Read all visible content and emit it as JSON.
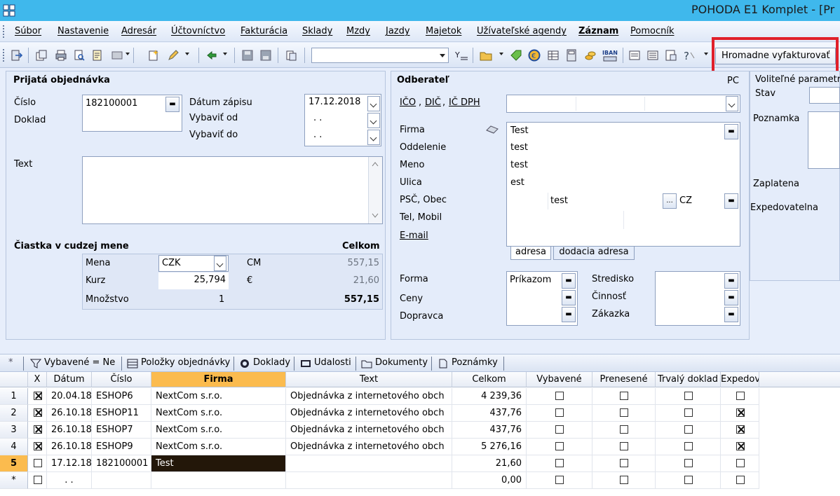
{
  "window": {
    "title": "POHODA E1 Komplet - [Pr"
  },
  "menu": [
    "Súbor",
    "Nastavenie",
    "Adresár",
    "Účtovníctvo",
    "Fakturácia",
    "Sklady",
    "Mzdy",
    "Jazdy",
    "Majetok",
    "Užívateľské agendy",
    "Záznam",
    "Pomocník"
  ],
  "toolbar": {
    "hromadne_label": "Hromadne vyfakturovať"
  },
  "order": {
    "section_title": "Prijatá objednávka",
    "cislo_label": "Číslo",
    "cislo_value": "182100001",
    "doklad_label": "Doklad",
    "datum_zapisu_label": "Dátum zápisu",
    "datum_zapisu_value": "17.12.2018",
    "vybavit_od_label": "Vybaviť od",
    "vybavit_od_value": ". .",
    "vybavit_do_label": "Vybaviť do",
    "vybavit_do_value": ". .",
    "text_label": "Text"
  },
  "foreign": {
    "section_title": "Čiastka v cudzej mene",
    "celkom_label": "Celkom",
    "mena_label": "Mena",
    "mena_value": "CZK",
    "kurz_label": "Kurz",
    "kurz_value": "25,794",
    "mnozstvo_label": "Množstvo",
    "mnozstvo_value": "1",
    "cm_label": "CM",
    "cm_value": "557,15",
    "eur_label": "€",
    "eur_value": "21,60",
    "total_value": "557,15"
  },
  "customer": {
    "section_title": "Odberateľ",
    "pc_label": "PC",
    "ico_label": "IČO",
    "dic_label": "DIČ",
    "icdph_label": "IČ DPH",
    "firma_label": "Firma",
    "oddelenie_label": "Oddelenie",
    "meno_label": "Meno",
    "ulica_label": "Ulica",
    "psc_label": "PSČ, Obec",
    "tel_label": "Tel, Mobil",
    "email_label": "E-mail",
    "firma_value": "Test",
    "oddelenie_value": "test",
    "meno_value": "test",
    "ulica_value": "est",
    "obec_value": "test",
    "country_value": "CZ",
    "tab_adresa": "adresa",
    "tab_dodacia": "dodacia adresa",
    "forma_label": "Forma",
    "forma_value": "Príkazom",
    "ceny_label": "Ceny",
    "dopravca_label": "Dopravca",
    "stredisko_label": "Stredisko",
    "cinnost_label": "Činnosť",
    "zakazka_label": "Zákazka"
  },
  "params": {
    "section_title": "Voliteľné parametr",
    "stav_label": "Stav",
    "poznamka_label": "Poznamka",
    "zaplatena_label": "Zaplatena",
    "expedovatelna_label": "Expedovatelna"
  },
  "tabs": [
    "Vybavené = Ne",
    "Položky objednávky",
    "Doklady",
    "Udalosti",
    "Dokumenty",
    "Poznámky"
  ],
  "grid": {
    "columns": [
      "X",
      "Dátum",
      "Číslo",
      "Firma",
      "Text",
      "Celkom",
      "Vybavené",
      "Prenesené",
      "Trvalý doklad",
      "Expedov"
    ],
    "rows": [
      {
        "num": "1",
        "x": true,
        "datum": "20.04.18",
        "cislo": "ESHOP6",
        "firma": "NextCom s.r.o.",
        "text": "Objednávka z internetového obch",
        "celkom": "4 239,36",
        "vybavene": false,
        "prenesene": false,
        "trvaly": false,
        "expedov": false
      },
      {
        "num": "2",
        "x": true,
        "datum": "26.10.18",
        "cislo": "ESHOP11",
        "firma": "NextCom s.r.o.",
        "text": "Objednávka z internetového obch",
        "celkom": "437,76",
        "vybavene": false,
        "prenesene": false,
        "trvaly": false,
        "expedov": true
      },
      {
        "num": "3",
        "x": true,
        "datum": "26.10.18",
        "cislo": "ESHOP7",
        "firma": "NextCom s.r.o.",
        "text": "Objednávka z internetového obch",
        "celkom": "437,76",
        "vybavene": false,
        "prenesene": false,
        "trvaly": false,
        "expedov": true
      },
      {
        "num": "4",
        "x": true,
        "datum": "26.10.18",
        "cislo": "ESHOP9",
        "firma": "NextCom s.r.o.",
        "text": "Objednávka z internetového obch",
        "celkom": "5 276,16",
        "vybavene": false,
        "prenesene": false,
        "trvaly": false,
        "expedov": true
      },
      {
        "num": "5",
        "x": false,
        "datum": "17.12.18",
        "cislo": "182100001",
        "firma": "Test",
        "text": "",
        "celkom": "21,60",
        "vybavene": false,
        "prenesene": false,
        "trvaly": false,
        "expedov": false
      },
      {
        "num": "*",
        "x": false,
        "datum": ". .",
        "cislo": "",
        "firma": "",
        "text": "",
        "celkom": "0,00",
        "vybavene": false,
        "prenesene": false,
        "trvaly": false,
        "expedov": false
      }
    ]
  }
}
